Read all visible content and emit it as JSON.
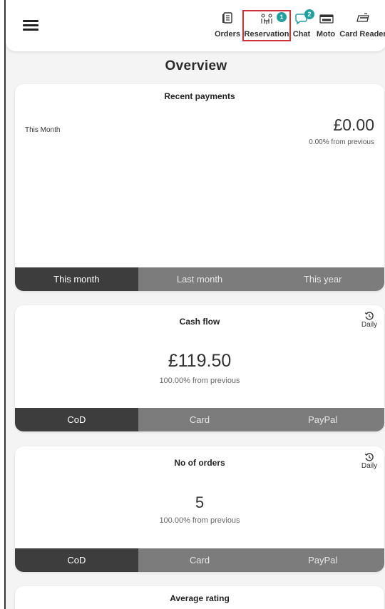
{
  "header": {
    "nav": [
      {
        "id": "orders",
        "label": "Orders",
        "icon": "orders-icon"
      },
      {
        "id": "reservation",
        "label": "Reservation",
        "icon": "reservation-icon",
        "badge": "1",
        "highlighted": true
      },
      {
        "id": "chat",
        "label": "Chat",
        "icon": "chat-icon",
        "badge": "2"
      },
      {
        "id": "moto",
        "label": "Moto",
        "icon": "moto-card-icon"
      },
      {
        "id": "card_reader",
        "label": "Card Reader",
        "icon": "card-reader-icon"
      }
    ],
    "badge_color": "#1ea0a0",
    "highlight_color": "#d0303a"
  },
  "page": {
    "title": "Overview"
  },
  "recent_payments": {
    "title": "Recent payments",
    "period_label": "This Month",
    "amount": "£0.00",
    "change": "0.00% from previous",
    "tabs": [
      "This month",
      "Last month",
      "This year"
    ],
    "active_tab": 0
  },
  "cash_flow": {
    "title": "Cash flow",
    "period": "Daily",
    "amount": "£119.50",
    "change": "100.00% from previous",
    "tabs": [
      "CoD",
      "Card",
      "PayPal"
    ],
    "active_tab": 0
  },
  "orders_count": {
    "title": "No of orders",
    "period": "Daily",
    "value": "5",
    "change": "100.00% from previous",
    "tabs": [
      "CoD",
      "Card",
      "PayPal"
    ],
    "active_tab": 0
  },
  "average_rating": {
    "title": "Average rating"
  },
  "colors": {
    "tab_active": "#3d3d3d",
    "tab_inactive": "#7c7c7c",
    "background": "#f4f4f4"
  }
}
